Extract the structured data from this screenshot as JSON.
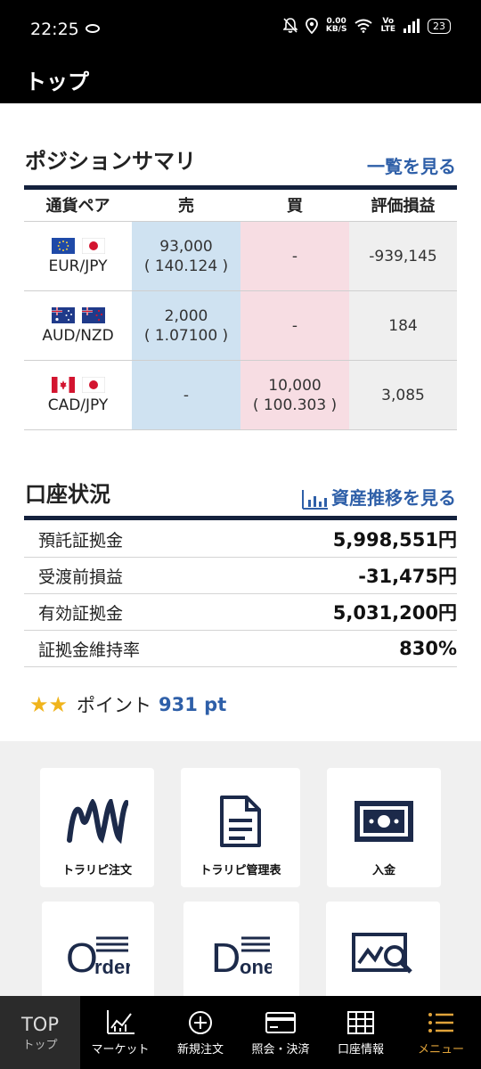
{
  "status": {
    "time": "22:25",
    "speed_top": "0.00",
    "speed_bottom": "KB/S",
    "volte_top": "Vo",
    "volte_bottom": "LTE",
    "battery": "23"
  },
  "header": {
    "title": "トップ"
  },
  "positions": {
    "title": "ポジションサマリ",
    "link": "一覧を見る",
    "headers": {
      "pair": "通貨ペア",
      "sell": "売",
      "buy": "買",
      "pl": "評価損益"
    },
    "rows": [
      {
        "pair": "EUR/JPY",
        "sell_qty": "93,000",
        "sell_rate": "( 140.124 )",
        "buy": "-",
        "pl": "-939,145"
      },
      {
        "pair": "AUD/NZD",
        "sell_qty": "2,000",
        "sell_rate": "( 1.07100 )",
        "buy": "-",
        "pl": "184"
      },
      {
        "pair": "CAD/JPY",
        "sell": "-",
        "buy_qty": "10,000",
        "buy_rate": "( 100.303 )",
        "pl": "3,085"
      }
    ]
  },
  "account": {
    "title": "口座状況",
    "link": "資産推移を見る",
    "rows": [
      {
        "label": "預託証拠金",
        "value": "5,998,551円"
      },
      {
        "label": "受渡前損益",
        "value": "-31,475円"
      },
      {
        "label": "有効証拠金",
        "value": "5,031,200円"
      },
      {
        "label": "証拠金維持率",
        "value": "830%"
      }
    ]
  },
  "points": {
    "stars": "★★",
    "label": "ポイント",
    "value": "931 pt"
  },
  "tiles": [
    {
      "label": "トラリピ注文",
      "icon": "trap-repeat-icon"
    },
    {
      "label": "トラリピ管理表",
      "icon": "document-icon"
    },
    {
      "label": "入金",
      "icon": "deposit-icon"
    },
    {
      "label": "Order",
      "icon": "order-icon"
    },
    {
      "label": "Done",
      "icon": "done-icon"
    },
    {
      "label": "",
      "icon": "chart-search-icon"
    }
  ],
  "tile_icons": {
    "order_o": "O",
    "order_rest": "rder",
    "done_d": "D",
    "done_rest": "one"
  },
  "nav": [
    {
      "label": "トップ",
      "top": "TOP"
    },
    {
      "label": "マーケット"
    },
    {
      "label": "新規注文"
    },
    {
      "label": "照会・決済"
    },
    {
      "label": "口座情報"
    },
    {
      "label": "メニュー"
    }
  ],
  "colors": {
    "accent": "#2e5fa8",
    "navy": "#14213d",
    "sell_bg": "#cfe2f1",
    "buy_bg": "#f7dde3",
    "menu": "#e0a33a",
    "star": "#f0b41c"
  }
}
